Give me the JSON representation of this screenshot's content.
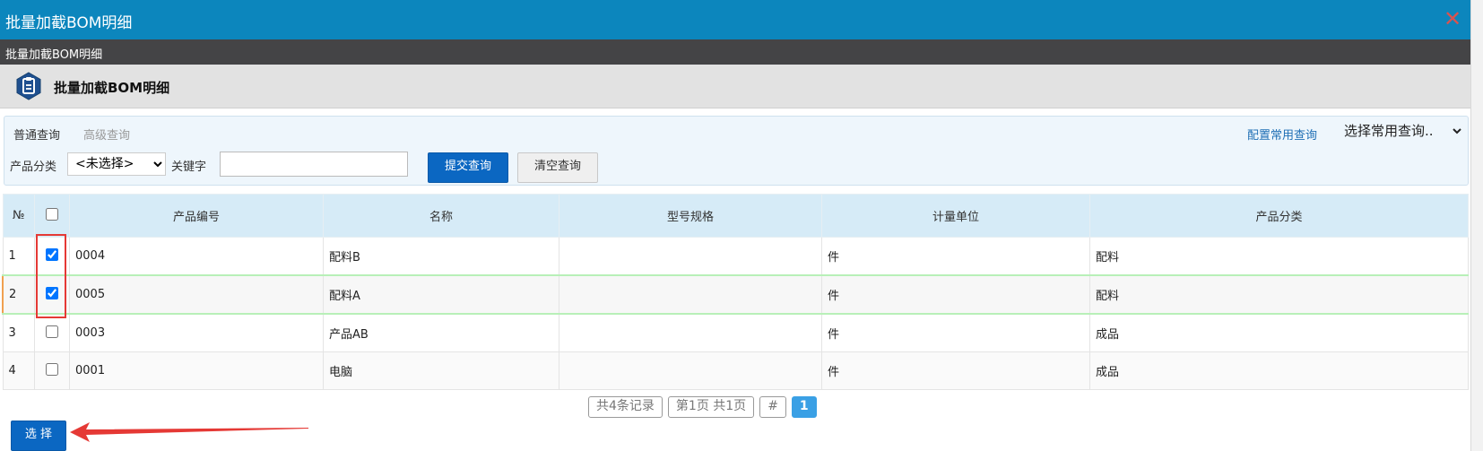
{
  "window": {
    "title": "批量加截BOM明细",
    "close_glyph": "✕"
  },
  "subbar": {
    "title": "批量加截BOM明细"
  },
  "page": {
    "title": "批量加截BOM明细",
    "icon": "clipboard-icon"
  },
  "query": {
    "tabs": [
      "普通查询",
      "高级查询"
    ],
    "config_link": "配置常用查询",
    "common_select": "选择常用查询..",
    "category_label": "产品分类",
    "category_value": "<未选择>",
    "keyword_label": "关键字",
    "keyword_value": "",
    "submit_label": "提交查询",
    "clear_label": "清空查询"
  },
  "table": {
    "headers": [
      "№",
      "",
      "产品编号",
      "名称",
      "型号规格",
      "计量单位",
      "产品分类"
    ],
    "rows": [
      {
        "num": "1",
        "checked": true,
        "code": "0004",
        "name": "配料B",
        "spec": "",
        "unit": "件",
        "category": "配料"
      },
      {
        "num": "2",
        "checked": true,
        "code": "0005",
        "name": "配料A",
        "spec": "",
        "unit": "件",
        "category": "配料"
      },
      {
        "num": "3",
        "checked": false,
        "code": "0003",
        "name": "产品AB",
        "spec": "",
        "unit": "件",
        "category": "成品"
      },
      {
        "num": "4",
        "checked": false,
        "code": "0001",
        "name": "电脑",
        "spec": "",
        "unit": "件",
        "category": "成品"
      }
    ]
  },
  "pager": {
    "total": "共4条记录",
    "page_info": "第1页 共1页",
    "hash": "#",
    "current": "1"
  },
  "footer": {
    "select_label": "选 择"
  },
  "colors": {
    "titlebar": "#0c86bd",
    "button": "#0b67c2",
    "header": "#d6ebf7",
    "annotation": "#e53935"
  }
}
